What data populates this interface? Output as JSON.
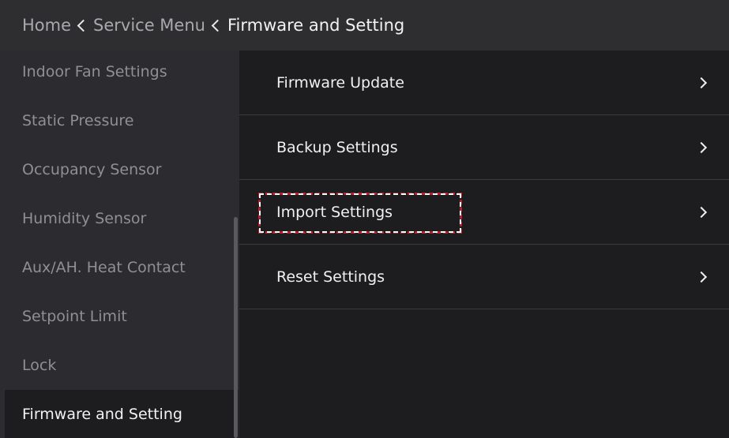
{
  "header": {
    "breadcrumbs": [
      "Home",
      "Service Menu",
      "Firmware and Setting"
    ]
  },
  "sidebar": {
    "items": [
      {
        "label": "Indoor Fan Settings"
      },
      {
        "label": "Static Pressure"
      },
      {
        "label": "Occupancy Sensor"
      },
      {
        "label": "Humidity Sensor"
      },
      {
        "label": "Aux/AH. Heat Contact"
      },
      {
        "label": "Setpoint Limit"
      },
      {
        "label": "Lock"
      },
      {
        "label": "Firmware and Setting"
      }
    ],
    "active_index": 7
  },
  "main": {
    "items": [
      {
        "label": "Firmware Update"
      },
      {
        "label": "Backup Settings"
      },
      {
        "label": "Import Settings"
      },
      {
        "label": "Reset Settings"
      }
    ],
    "highlighted_index": 2
  },
  "colors": {
    "highlight_red": "#b51f2e",
    "background": "#1d1d1f",
    "sidebar": "#2c2c30",
    "header": "#2e2e31"
  },
  "icons": {
    "breadcrumb_separator": "chevron-left-icon",
    "row_arrow": "chevron-right-icon"
  }
}
